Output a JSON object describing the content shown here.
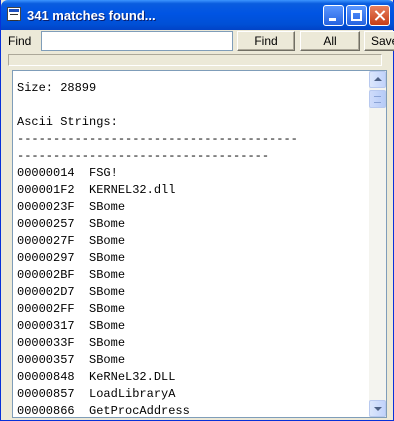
{
  "window": {
    "title": "341 matches found..."
  },
  "toolbar": {
    "find_label": "Find",
    "search_value": "",
    "find_button": "Find",
    "all_button": "All",
    "save_button": "Save"
  },
  "progress": {
    "value": 0
  },
  "list": {
    "lines": [
      "Size: 28899",
      "",
      "Ascii Strings:",
      "---------------------------------------",
      "-----------------------------------",
      "00000014  FSG!",
      "000001F2  KERNEL32.dll",
      "0000023F  SBome",
      "00000257  SBome",
      "0000027F  SBome",
      "00000297  SBome",
      "000002BF  SBome",
      "000002D7  SBome",
      "000002FF  SBome",
      "00000317  SBome",
      "0000033F  SBome",
      "00000357  SBome",
      "00000848  KeRNeL32.DLL",
      "00000857  LoadLibraryA",
      "00000866  GetProcAddress"
    ]
  }
}
